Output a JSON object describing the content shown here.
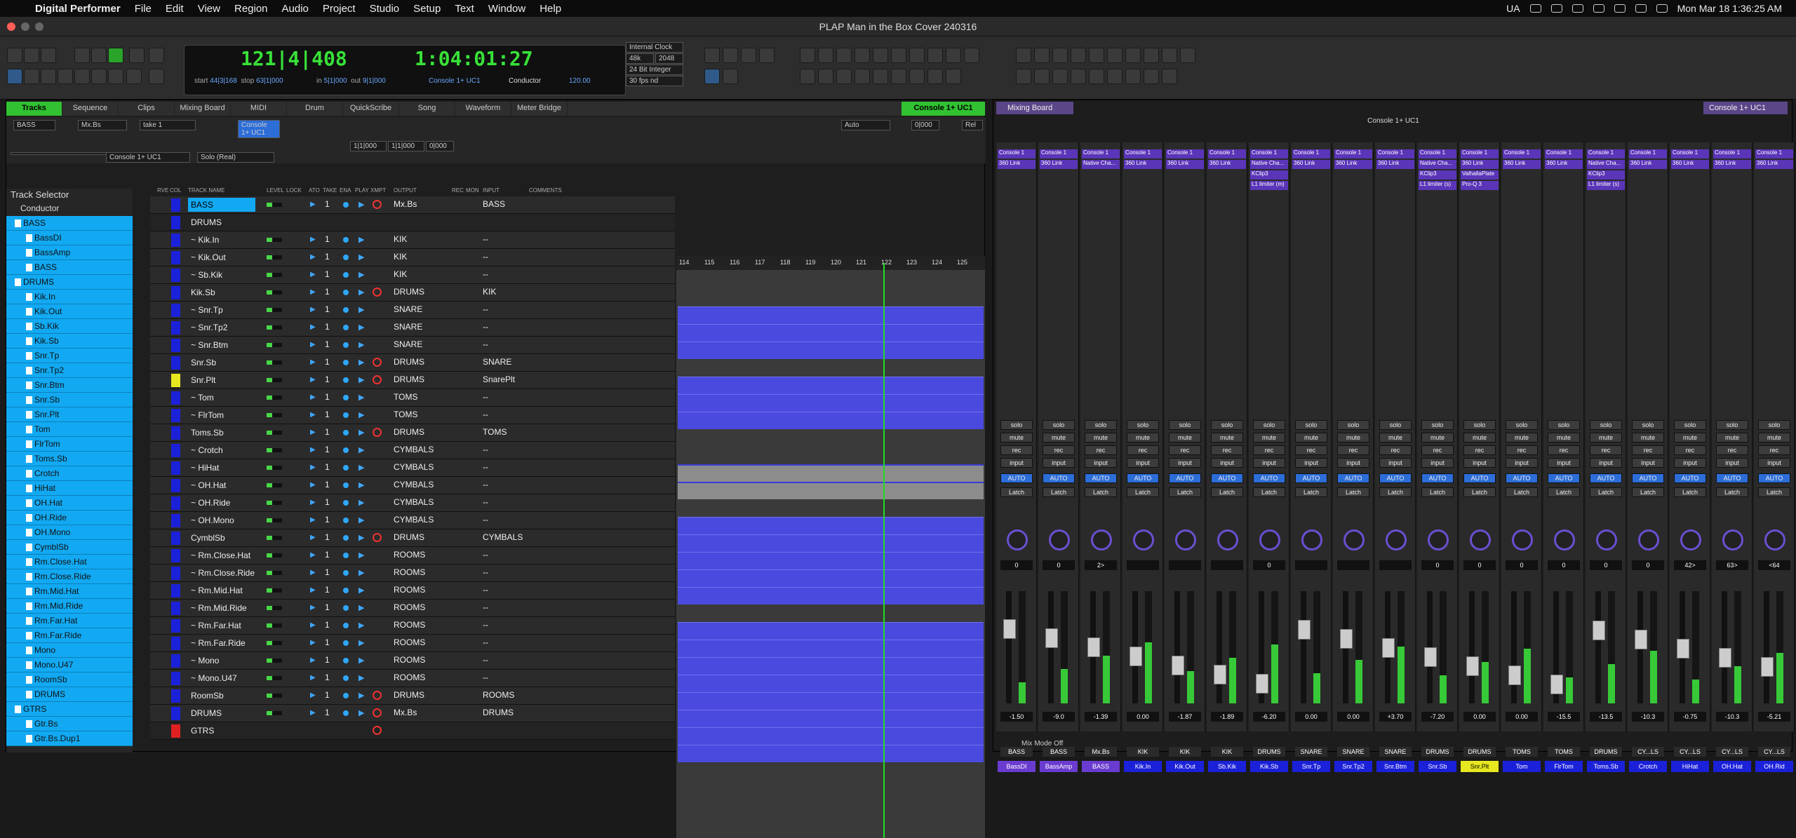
{
  "menubar": {
    "app": "Digital Performer",
    "items": [
      "File",
      "Edit",
      "View",
      "Region",
      "Audio",
      "Project",
      "Studio",
      "Setup",
      "Text",
      "Window",
      "Help"
    ],
    "lang": "UA",
    "datetime": "Mon Mar 18  1:36:25 AM"
  },
  "window": {
    "title": "PLAP Man in the Box Cover 240316"
  },
  "transport": {
    "counter": "121|4|408",
    "time": "1:04:01:27",
    "start_label": "start",
    "start": "44|3|168",
    "stop_label": "stop",
    "stop": "63|1|000",
    "in_label": "in",
    "in": "5|1|000",
    "out_label": "out",
    "out": "9|1|000",
    "console": "Console 1+ UC1",
    "conductor": "Conductor",
    "tempo": "120.00",
    "clock": "Internal Clock",
    "rate": "48k",
    "buffer": "2048",
    "bits": "24 Bit Integer",
    "fps": "30 fps nd"
  },
  "tabs": [
    "Tracks",
    "Sequence",
    "Clips",
    "Mixing Board",
    "MIDI",
    "Drum",
    "QuickScribe",
    "Song",
    "Waveform",
    "Meter Bridge"
  ],
  "console_tab": "Console 1+ UC1",
  "controls": {
    "track": "BASS",
    "output": "Mx.Bs",
    "take": "take 1",
    "console": "Console 1+ UC1",
    "solo": "Solo (Real)",
    "auto": "Auto",
    "sel_start": "1|1|000",
    "sel_end": "1|1|000",
    "sel_len": "0|000",
    "rel": "Rel",
    "time": "0|000"
  },
  "selector": {
    "title": "Track Selector",
    "items": [
      "Conductor",
      "BASS",
      "BassDI",
      "BassAmp",
      "BASS",
      "DRUMS",
      "Kik.In",
      "Kik.Out",
      "Sb.Kik",
      "Kik.Sb",
      "Snr.Tp",
      "Snr.Tp2",
      "Snr.Btm",
      "Snr.Sb",
      "Snr.Plt",
      "Tom",
      "FlrTom",
      "Toms.Sb",
      "Crotch",
      "HiHat",
      "OH.Hat",
      "OH.Ride",
      "OH.Mono",
      "CymblSb",
      "Rm.Close.Hat",
      "Rm.Close.Ride",
      "Rm.Mid.Hat",
      "Rm.Mid.Ride",
      "Rm.Far.Hat",
      "Rm.Far.Ride",
      "Mono",
      "Mono.U47",
      "RoomSb",
      "DRUMS",
      "GTRS",
      "Gtr.Bs",
      "Gtr.Bs.Dup1"
    ]
  },
  "track_headers": [
    "RVE",
    "COL",
    "TRACK NAME",
    "LEVEL",
    "LOCK",
    "ATO",
    "TAKE",
    "ENA",
    "PLAY",
    "XMPT",
    "OUTPUT",
    "REC",
    "MON",
    "INPUT",
    "COMMENTS"
  ],
  "tracks": [
    {
      "name": "BASS",
      "out": "Mx.Bs",
      "inp": "BASS",
      "kind": "gray",
      "sel": true,
      "rec": true
    },
    {
      "name": "DRUMS",
      "out": "",
      "inp": "",
      "kind": "folder",
      "sel": false,
      "rec": false
    },
    {
      "name": "~ Kik.In",
      "out": "KIK",
      "inp": "--",
      "kind": "audio",
      "sel": false,
      "rec": false
    },
    {
      "name": "~ Kik.Out",
      "out": "KIK",
      "inp": "--",
      "kind": "audio",
      "sel": false,
      "rec": false
    },
    {
      "name": "~ Sb.Kik",
      "out": "KIK",
      "inp": "--",
      "kind": "audio",
      "sel": false,
      "rec": false
    },
    {
      "name": "Kik.Sb",
      "out": "DRUMS",
      "inp": "KIK",
      "kind": "gray",
      "sel": false,
      "rec": true
    },
    {
      "name": "~ Snr.Tp",
      "out": "SNARE",
      "inp": "--",
      "kind": "audio",
      "sel": false,
      "rec": false
    },
    {
      "name": "~ Snr.Tp2",
      "out": "SNARE",
      "inp": "--",
      "kind": "audio",
      "sel": false,
      "rec": false
    },
    {
      "name": "~ Snr.Btm",
      "out": "SNARE",
      "inp": "--",
      "kind": "audio",
      "sel": false,
      "rec": false
    },
    {
      "name": "Snr.Sb",
      "out": "DRUMS",
      "inp": "SNARE",
      "kind": "gray",
      "sel": false,
      "rec": true
    },
    {
      "name": "Snr.Plt",
      "out": "DRUMS",
      "inp": "SnarePlt",
      "kind": "gray",
      "sel": false,
      "rec": true
    },
    {
      "name": "~ Tom",
      "out": "TOMS",
      "inp": "--",
      "kind": "light",
      "sel": false,
      "rec": false
    },
    {
      "name": "~ FlrTom",
      "out": "TOMS",
      "inp": "--",
      "kind": "light",
      "sel": false,
      "rec": false
    },
    {
      "name": "Toms.Sb",
      "out": "DRUMS",
      "inp": "TOMS",
      "kind": "gray",
      "sel": false,
      "rec": true
    },
    {
      "name": "~ Crotch",
      "out": "CYMBALS",
      "inp": "--",
      "kind": "audio",
      "sel": false,
      "rec": false
    },
    {
      "name": "~ HiHat",
      "out": "CYMBALS",
      "inp": "--",
      "kind": "audio",
      "sel": false,
      "rec": false
    },
    {
      "name": "~ OH.Hat",
      "out": "CYMBALS",
      "inp": "--",
      "kind": "audio",
      "sel": false,
      "rec": false
    },
    {
      "name": "~ OH.Ride",
      "out": "CYMBALS",
      "inp": "--",
      "kind": "audio",
      "sel": false,
      "rec": false
    },
    {
      "name": "~ OH.Mono",
      "out": "CYMBALS",
      "inp": "--",
      "kind": "audio",
      "sel": false,
      "rec": false
    },
    {
      "name": "CymblSb",
      "out": "DRUMS",
      "inp": "CYMBALS",
      "kind": "gray",
      "sel": false,
      "rec": true
    },
    {
      "name": "~ Rm.Close.Hat",
      "out": "ROOMS",
      "inp": "--",
      "kind": "audio",
      "sel": false,
      "rec": false
    },
    {
      "name": "~ Rm.Close.Ride",
      "out": "ROOMS",
      "inp": "--",
      "kind": "audio",
      "sel": false,
      "rec": false
    },
    {
      "name": "~ Rm.Mid.Hat",
      "out": "ROOMS",
      "inp": "--",
      "kind": "audio",
      "sel": false,
      "rec": false
    },
    {
      "name": "~ Rm.Mid.Ride",
      "out": "ROOMS",
      "inp": "--",
      "kind": "audio",
      "sel": false,
      "rec": false
    },
    {
      "name": "~ Rm.Far.Hat",
      "out": "ROOMS",
      "inp": "--",
      "kind": "audio",
      "sel": false,
      "rec": false
    },
    {
      "name": "~ Rm.Far.Ride",
      "out": "ROOMS",
      "inp": "--",
      "kind": "audio",
      "sel": false,
      "rec": false
    },
    {
      "name": "~ Mono",
      "out": "ROOMS",
      "inp": "--",
      "kind": "audio",
      "sel": false,
      "rec": false
    },
    {
      "name": "~ Mono.U47",
      "out": "ROOMS",
      "inp": "--",
      "kind": "audio",
      "sel": false,
      "rec": false
    },
    {
      "name": "RoomSb",
      "out": "DRUMS",
      "inp": "ROOMS",
      "kind": "gray",
      "sel": false,
      "rec": true
    },
    {
      "name": "DRUMS",
      "out": "Mx.Bs",
      "inp": "DRUMS",
      "kind": "gray",
      "sel": false,
      "rec": true
    },
    {
      "name": "GTRS",
      "out": "",
      "inp": "",
      "kind": "folder",
      "sel": false,
      "rec": true
    }
  ],
  "ruler": [
    "114",
    "115",
    "116",
    "117",
    "118",
    "119",
    "120",
    "121",
    "122",
    "123",
    "124",
    "125"
  ],
  "mixer": {
    "title": "Mixing Board",
    "console": "Console 1+ UC1",
    "strips": [
      {
        "name": "BassDI",
        "color": "#6a3bd0",
        "ins": [
          "Console 1",
          "360 Link"
        ],
        "vol": "-1.50",
        "pan": "0",
        "out": "BASS"
      },
      {
        "name": "BassAmp",
        "color": "#6a3bd0",
        "ins": [
          "Console 1",
          "360 Link"
        ],
        "vol": "-9.0",
        "pan": "0",
        "out": "BASS"
      },
      {
        "name": "BASS",
        "color": "#6a3bd0",
        "ins": [
          "Console 1",
          "Native Cha..."
        ],
        "vol": "-1.39",
        "pan": "2>",
        "out": "Mx.Bs"
      },
      {
        "name": "Kik.In",
        "color": "#1b21d9",
        "ins": [
          "Console 1",
          "360 Link"
        ],
        "vol": "0.00",
        "pan": "",
        "out": "KIK"
      },
      {
        "name": "Kik.Out",
        "color": "#1b21d9",
        "ins": [
          "Console 1",
          "360 Link"
        ],
        "vol": "-1.87",
        "pan": "",
        "out": "KIK"
      },
      {
        "name": "Sb.Kik",
        "color": "#1b21d9",
        "ins": [
          "Console 1",
          "360 Link"
        ],
        "vol": "-1.89",
        "pan": "",
        "out": "KIK"
      },
      {
        "name": "Kik.Sb",
        "color": "#1b21d9",
        "ins": [
          "Console 1",
          "Native Cha...",
          "KClip3",
          "L1 limiter (m)"
        ],
        "vol": "-6.20",
        "pan": "0",
        "out": "DRUMS"
      },
      {
        "name": "Snr.Tp",
        "color": "#1b21d9",
        "ins": [
          "Console 1",
          "360 Link"
        ],
        "vol": "0.00",
        "pan": "",
        "out": "SNARE"
      },
      {
        "name": "Snr.Tp2",
        "color": "#1b21d9",
        "ins": [
          "Console 1",
          "360 Link"
        ],
        "vol": "0.00",
        "pan": "",
        "out": "SNARE"
      },
      {
        "name": "Snr.Btm",
        "color": "#1b21d9",
        "ins": [
          "Console 1",
          "360 Link"
        ],
        "vol": "+3.70",
        "pan": "",
        "out": "SNARE"
      },
      {
        "name": "Snr.Sb",
        "color": "#1b21d9",
        "ins": [
          "Console 1",
          "Native Cha...",
          "KClip3",
          "L1 limiter (s)"
        ],
        "vol": "-7.20",
        "pan": "0",
        "out": "DRUMS"
      },
      {
        "name": "Snr.Plt",
        "color": "#e8e820",
        "ins": [
          "Console 1",
          "360 Link",
          "ValhallaPlate",
          "Pro-Q 3"
        ],
        "vol": "0.00",
        "pan": "0",
        "out": "DRUMS"
      },
      {
        "name": "Tom",
        "color": "#1b21d9",
        "ins": [
          "Console 1",
          "360 Link"
        ],
        "vol": "0.00",
        "pan": "0",
        "out": "TOMS"
      },
      {
        "name": "FlrTom",
        "color": "#1b21d9",
        "ins": [
          "Console 1",
          "360 Link"
        ],
        "vol": "-15.5",
        "pan": "0",
        "out": "TOMS"
      },
      {
        "name": "Toms.Sb",
        "color": "#1b21d9",
        "ins": [
          "Console 1",
          "Native Cha...",
          "KClip3",
          "L1 limiter (s)"
        ],
        "vol": "-13.5",
        "pan": "0",
        "out": "DRUMS"
      },
      {
        "name": "Crotch",
        "color": "#1b21d9",
        "ins": [
          "Console 1",
          "360 Link"
        ],
        "vol": "-10.3",
        "pan": "0",
        "out": "CY...LS"
      },
      {
        "name": "HiHat",
        "color": "#1b21d9",
        "ins": [
          "Console 1",
          "360 Link"
        ],
        "vol": "-0.75",
        "pan": "42>",
        "out": "CY...LS"
      },
      {
        "name": "OH.Hat",
        "color": "#1b21d9",
        "ins": [
          "Console 1",
          "360 Link"
        ],
        "vol": "-10.3",
        "pan": "63>",
        "out": "CY...LS"
      },
      {
        "name": "OH.Rid",
        "color": "#1b21d9",
        "ins": [
          "Console 1",
          "360 Link"
        ],
        "vol": "-5.21",
        "pan": "<64",
        "out": "CY...LS"
      }
    ],
    "labels": {
      "solo": "solo",
      "mute": "mute",
      "rec": "rec",
      "input": "input",
      "latch": "Latch",
      "auto": "AUTO"
    }
  },
  "statusbar": {
    "mixmode": "Mix Mode Off"
  }
}
